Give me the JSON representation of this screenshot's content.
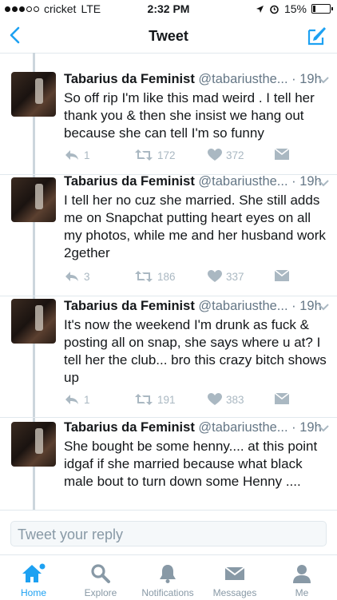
{
  "status_bar": {
    "carrier": "cricket",
    "network": "LTE",
    "time": "2:32 PM",
    "battery": "15%",
    "battery_level": 0.15
  },
  "nav": {
    "title": "Tweet",
    "back_icon": "chevron-left-icon",
    "compose_icon": "compose-tweet-icon"
  },
  "colors": {
    "accent": "#1da1f2",
    "muted": "#aab8c2",
    "divider": "#e1e8ed"
  },
  "tweets": [
    {
      "name": "Tabarius da Feminist",
      "handle": "@tabariusthe...",
      "time": "· 19h",
      "text": "So off rip I'm like this mad weird . I tell her thank you & then she insist we hang out because she can tell I'm so funny",
      "replies": "1",
      "retweets": "172",
      "likes": "372"
    },
    {
      "name": "Tabarius da Feminist",
      "handle": "@tabariusthe...",
      "time": "· 19h",
      "text": "I tell her no cuz she married. She still adds me on Snapchat putting heart eyes on all my photos, while me and her husband work 2gether",
      "replies": "3",
      "retweets": "186",
      "likes": "337"
    },
    {
      "name": "Tabarius da Feminist",
      "handle": "@tabariusthe...",
      "time": "· 19h",
      "text": "It's now the weekend I'm drunk as fuck & posting all on snap, she says where u at? I tell her the club... bro this crazy bitch shows up",
      "replies": "1",
      "retweets": "191",
      "likes": "383"
    },
    {
      "name": "Tabarius da Feminist",
      "handle": "@tabariusthe...",
      "time": "· 19h",
      "text": "She bought be some henny.... at this point idgaf if she married because what black male bout to turn down some Henny ....",
      "replies": "",
      "retweets": "",
      "likes": ""
    }
  ],
  "reply_box": {
    "placeholder": "Tweet your reply"
  },
  "tabs": [
    {
      "label": "Home",
      "icon": "home-icon",
      "active": true
    },
    {
      "label": "Explore",
      "icon": "search-icon",
      "active": false
    },
    {
      "label": "Notifications",
      "icon": "bell-icon",
      "active": false
    },
    {
      "label": "Messages",
      "icon": "envelope-icon",
      "active": false
    },
    {
      "label": "Me",
      "icon": "person-icon",
      "active": false
    }
  ]
}
